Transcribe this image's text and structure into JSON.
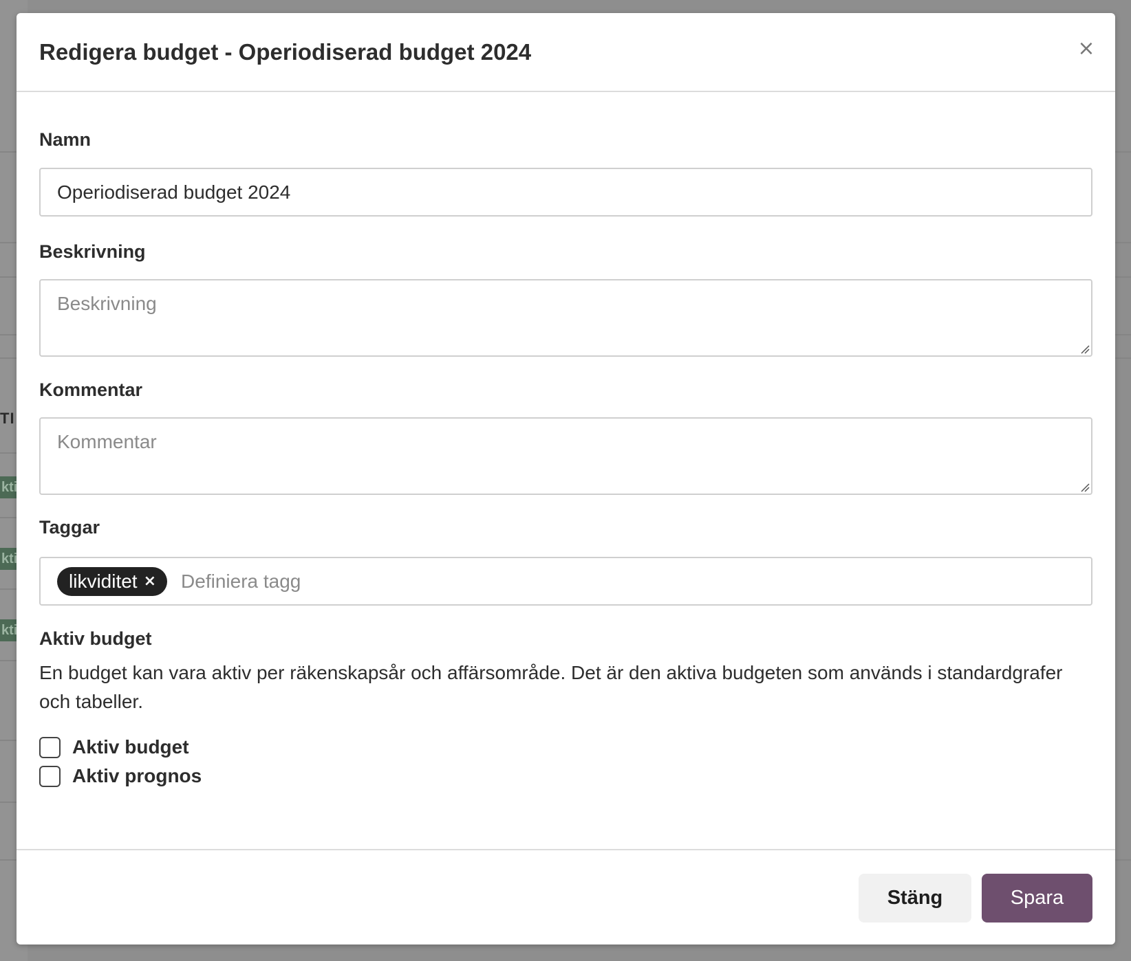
{
  "background": {
    "partial_header_text": "TI",
    "badges": [
      "kti",
      "kti",
      "kti"
    ]
  },
  "modal": {
    "title": "Redigera budget - Operiodiserad budget 2024",
    "close_icon": "close-icon"
  },
  "form": {
    "name": {
      "label": "Namn",
      "value": "Operiodiserad budget 2024"
    },
    "description": {
      "label": "Beskrivning",
      "placeholder": "Beskrivning",
      "value": ""
    },
    "comment": {
      "label": "Kommentar",
      "placeholder": "Kommentar",
      "value": ""
    },
    "tags": {
      "label": "Taggar",
      "items": [
        {
          "label": "likviditet",
          "remove_icon": "close-icon"
        }
      ],
      "placeholder": "Definiera tagg"
    },
    "active": {
      "heading": "Aktiv budget",
      "help_text": "En budget kan vara aktiv per räkenskapsår och affärsområde. Det är den aktiva budgeten som används i standardgrafer och tabeller.",
      "options": [
        {
          "label": "Aktiv budget",
          "checked": false
        },
        {
          "label": "Aktiv prognos",
          "checked": false
        }
      ]
    }
  },
  "footer": {
    "close_label": "Stäng",
    "save_label": "Spara"
  },
  "colors": {
    "accent": "#6e4f6e",
    "tag_background": "#222222",
    "overlay": "#8e8e8e"
  }
}
